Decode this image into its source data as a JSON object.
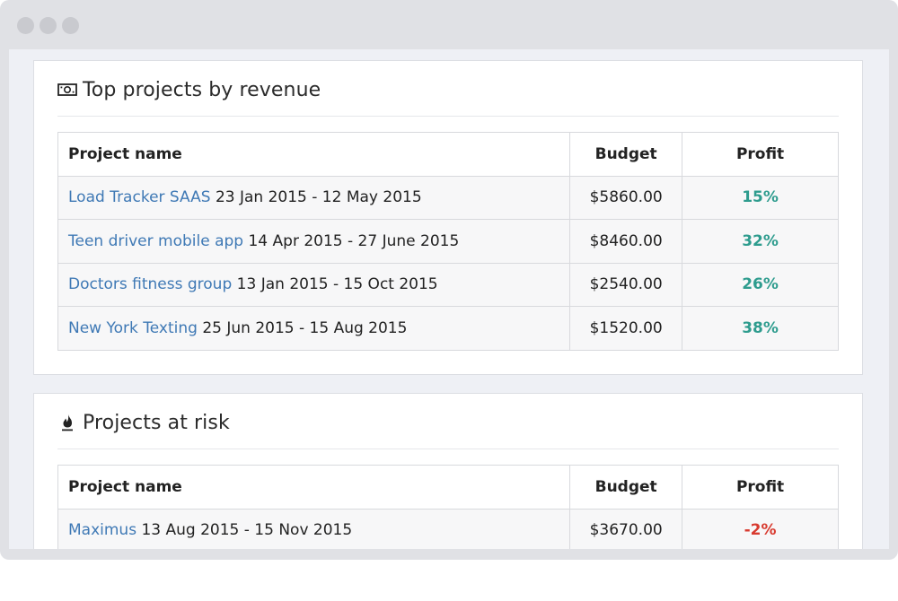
{
  "window": {
    "dots": [
      "close",
      "minimize",
      "maximize"
    ]
  },
  "colors": {
    "link": "#3f79b5",
    "profit_positive": "#2e9c8e",
    "profit_negative": "#d83a2f"
  },
  "top_projects": {
    "icon": "money-bill-icon",
    "title": "Top projects by revenue",
    "columns": {
      "name": "Project name",
      "budget": "Budget",
      "profit": "Profit"
    },
    "rows": [
      {
        "name": "Load Tracker SAAS",
        "dates": "23 Jan 2015 - 12 May 2015",
        "budget": "$5860.00",
        "profit": "15%"
      },
      {
        "name": "Teen driver mobile app",
        "dates": "14 Apr 2015 - 27 June 2015",
        "budget": "$8460.00",
        "profit": "32%"
      },
      {
        "name": "Doctors fitness group",
        "dates": "13 Jan 2015 - 15 Oct 2015",
        "budget": "$2540.00",
        "profit": "26%"
      },
      {
        "name": "New York Texting",
        "dates": "25 Jun 2015 - 15 Aug 2015",
        "budget": "$1520.00",
        "profit": "38%"
      }
    ]
  },
  "at_risk": {
    "icon": "fire-icon",
    "title": "Projects at risk",
    "columns": {
      "name": "Project name",
      "budget": "Budget",
      "profit": "Profit"
    },
    "rows": [
      {
        "name": "Maximus",
        "dates": "13 Aug 2015 - 15 Nov 2015",
        "budget": "$3670.00",
        "profit": "-2%"
      }
    ]
  }
}
